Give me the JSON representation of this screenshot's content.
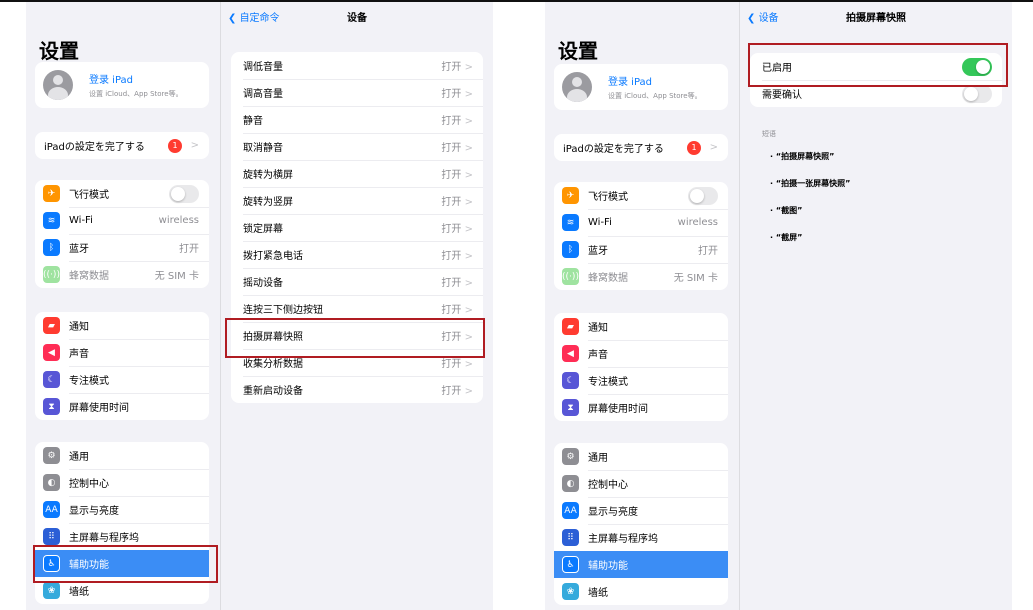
{
  "left_screen": {
    "sidebar": {
      "title": "设置",
      "profile": {
        "name": "登录 iPad",
        "subtitle": "设置 iCloud、App Store等。"
      },
      "setup_label": "iPadの設定を完了する",
      "setup_badge": "1",
      "connectivity": [
        {
          "label": "飞行模式",
          "icon": "airplane-icon",
          "color": "#ff9500",
          "toggle": "off"
        },
        {
          "label": "Wi-Fi",
          "icon": "wifi-icon",
          "color": "#0a7aff",
          "value": "wireless"
        },
        {
          "label": "蓝牙",
          "icon": "bluetooth-icon",
          "color": "#0a7aff",
          "value": "打开"
        },
        {
          "label": "蜂窝数据",
          "icon": "cellular-icon",
          "color": "#9fe3a0",
          "value": "无 SIM 卡"
        }
      ],
      "notifications": [
        {
          "label": "通知",
          "icon": "bell-icon",
          "color": "#ff3b30"
        },
        {
          "label": "声音",
          "icon": "speaker-icon",
          "color": "#ff2d55"
        },
        {
          "label": "专注模式",
          "icon": "moon-icon",
          "color": "#5856d6"
        },
        {
          "label": "屏幕使用时间",
          "icon": "hourglass-icon",
          "color": "#5856d6"
        }
      ],
      "general": [
        {
          "label": "通用",
          "icon": "gear-icon",
          "color": "#8e8e93"
        },
        {
          "label": "控制中心",
          "icon": "switches-icon",
          "color": "#8e8e93"
        },
        {
          "label": "显示与亮度",
          "icon": "text-size-icon",
          "color": "#0a7aff",
          "glyph": "AA"
        },
        {
          "label": "主屏幕与程序坞",
          "icon": "home-grid-icon",
          "color": "#2c5fd6"
        },
        {
          "label": "辅助功能",
          "icon": "accessibility-icon",
          "color": "#0a7aff",
          "active": true
        },
        {
          "label": "墙纸",
          "icon": "wallpaper-icon",
          "color": "#35aadc"
        }
      ]
    },
    "detail": {
      "back_label": "自定命令",
      "title": "设备",
      "rows": [
        {
          "label": "调低音量",
          "value": "打开"
        },
        {
          "label": "调高音量",
          "value": "打开"
        },
        {
          "label": "静音",
          "value": "打开"
        },
        {
          "label": "取消静音",
          "value": "打开"
        },
        {
          "label": "旋转为横屏",
          "value": "打开"
        },
        {
          "label": "旋转为竖屏",
          "value": "打开"
        },
        {
          "label": "锁定屏幕",
          "value": "打开"
        },
        {
          "label": "拨打紧急电话",
          "value": "打开"
        },
        {
          "label": "摇动设备",
          "value": "打开"
        },
        {
          "label": "连按三下侧边按钮",
          "value": "打开"
        },
        {
          "label": "拍摄屏幕快照",
          "value": "打开"
        },
        {
          "label": "收集分析数据",
          "value": "打开"
        },
        {
          "label": "重新启动设备",
          "value": "打开"
        }
      ]
    }
  },
  "right_screen": {
    "sidebar": {
      "title": "设置",
      "profile": {
        "name": "登录 iPad",
        "subtitle": "设置 iCloud、App Store等。"
      },
      "setup_label": "iPadの設定を完了する",
      "setup_badge": "1",
      "connectivity": [
        {
          "label": "飞行模式",
          "icon": "airplane-icon",
          "color": "#ff9500",
          "toggle": "off"
        },
        {
          "label": "Wi-Fi",
          "icon": "wifi-icon",
          "color": "#0a7aff",
          "value": "wireless"
        },
        {
          "label": "蓝牙",
          "icon": "bluetooth-icon",
          "color": "#0a7aff",
          "value": "打开"
        },
        {
          "label": "蜂窝数据",
          "icon": "cellular-icon",
          "color": "#9fe3a0",
          "value": "无 SIM 卡"
        }
      ],
      "notifications": [
        {
          "label": "通知",
          "icon": "bell-icon",
          "color": "#ff3b30"
        },
        {
          "label": "声音",
          "icon": "speaker-icon",
          "color": "#ff2d55"
        },
        {
          "label": "专注模式",
          "icon": "moon-icon",
          "color": "#5856d6"
        },
        {
          "label": "屏幕使用时间",
          "icon": "hourglass-icon",
          "color": "#5856d6"
        }
      ],
      "general": [
        {
          "label": "通用",
          "icon": "gear-icon",
          "color": "#8e8e93"
        },
        {
          "label": "控制中心",
          "icon": "switches-icon",
          "color": "#8e8e93"
        },
        {
          "label": "显示与亮度",
          "icon": "text-size-icon",
          "color": "#0a7aff",
          "glyph": "AA"
        },
        {
          "label": "主屏幕与程序坞",
          "icon": "home-grid-icon",
          "color": "#2c5fd6"
        },
        {
          "label": "辅助功能",
          "icon": "accessibility-icon",
          "color": "#0a7aff",
          "active": true
        },
        {
          "label": "墙纸",
          "icon": "wallpaper-icon",
          "color": "#35aadc"
        }
      ]
    },
    "detail": {
      "back_label": "设备",
      "title": "拍摄屏幕快照",
      "enabled_label": "已启用",
      "enabled_state": "on",
      "confirm_label": "需要确认",
      "confirm_state": "off",
      "phrases_heading": "短语",
      "phrases": [
        "“拍摄屏幕快照”",
        "“拍摄一张屏幕快照”",
        "“截图”",
        "“截屏”"
      ]
    }
  },
  "colors": {
    "accent": "#0a7aff",
    "highlight": "#b01c22",
    "toggle_on": "#34c759"
  }
}
